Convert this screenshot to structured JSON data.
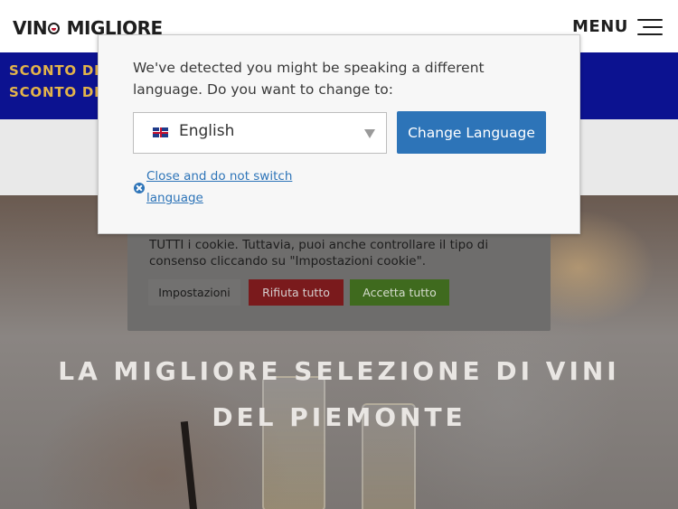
{
  "header": {
    "logo_text_1": "VIN",
    "logo_text_2": "MIGLIORE",
    "menu_label": "MENU"
  },
  "promo": {
    "line1": "SCONTO DE",
    "line2": "SCONTO DE"
  },
  "hero": {
    "title_line1": "LA MIGLIORE SELEZIONE DI VINI",
    "title_line2": "DEL PIEMONTE"
  },
  "cookie_banner": {
    "text": "TUTTI i cookie. Tuttavia, puoi anche controllare il tipo di consenso cliccando su \"Impostazioni cookie\".",
    "settings_label": "Impostazioni",
    "reject_label": "Rifiuta tutto",
    "accept_label": "Accetta tutto"
  },
  "language_modal": {
    "message": "We've detected you might be speaking a different language. Do you want to change to:",
    "selected_language": "English",
    "change_button_label": "Change Language",
    "close_link_label": "Close and do not switch language"
  },
  "colors": {
    "promo_bg": "#0c1290",
    "promo_text": "#e3b44a",
    "accent_blue": "#2d74b8"
  },
  "icons": [
    "hamburger-icon",
    "uk-flag-icon",
    "dropdown-arrow-icon",
    "close-icon"
  ]
}
